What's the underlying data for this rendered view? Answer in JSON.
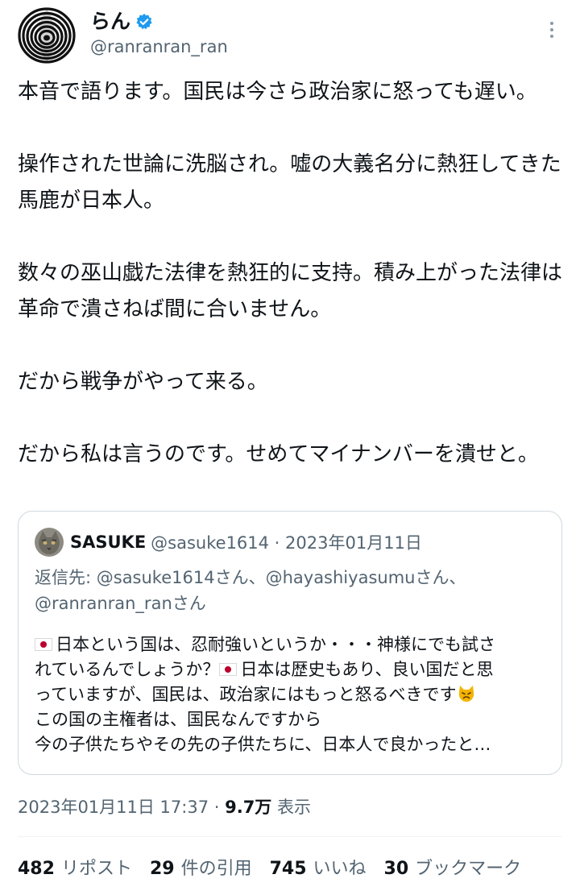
{
  "author": {
    "display_name": "らん",
    "handle": "@ranranran_ran",
    "verified": true,
    "verified_color": "#1d9bf0",
    "avatar_icon": "spiral-avatar-icon"
  },
  "more_icon": "more-vertical-icon",
  "tweet": {
    "paragraphs": [
      "本音で語ります。国民は今さら政治家に怒っても遅い。",
      "操作された世論に洗脳され。嘘の大義名分に熱狂してきた馬鹿が日本人。",
      "数々の巫山戯た法律を熱狂的に支持。積み上がった法律は革命で潰さねば間に合いません。",
      "だから戦争がやって来る。",
      "だから私は言うのです。せめてマイナンバーを潰せと。"
    ]
  },
  "quote": {
    "author_name": "SASUKE",
    "meta": "@sasuke1614 · 2023年01月11日",
    "reply_line1": "返信先: @sasuke1614さん、@hayashiyasumuさん、",
    "reply_line2": "@ranranran_ranさん",
    "line1": "日本という国は、忍耐強いというか・・・神様にでも試さ",
    "line2a": "れているんでしょうか？",
    "line2b": "日本は歴史もあり、良い国だと思",
    "line3": "っていますが、国民は、政治家にはもっと怒るべきです",
    "line4": "この国の主権者は、国民なんですから",
    "line5": "今の子供たちやその先の子供たちに、日本人で良かったと…",
    "flag_icon": "japan-flag-icon",
    "emoji_icon": "angry-cat-icon"
  },
  "timestamp": {
    "time": "2023年01月11日 17:37 · ",
    "views_count": "9.7万",
    "views_label": " 表示"
  },
  "stats": {
    "reposts_count": "482",
    "reposts_label": "リポスト",
    "quotes_count": "29",
    "quotes_label": "件の引用",
    "likes_count": "745",
    "likes_label": "いいね",
    "bookmarks_count": "30",
    "bookmarks_label": "ブックマーク"
  }
}
